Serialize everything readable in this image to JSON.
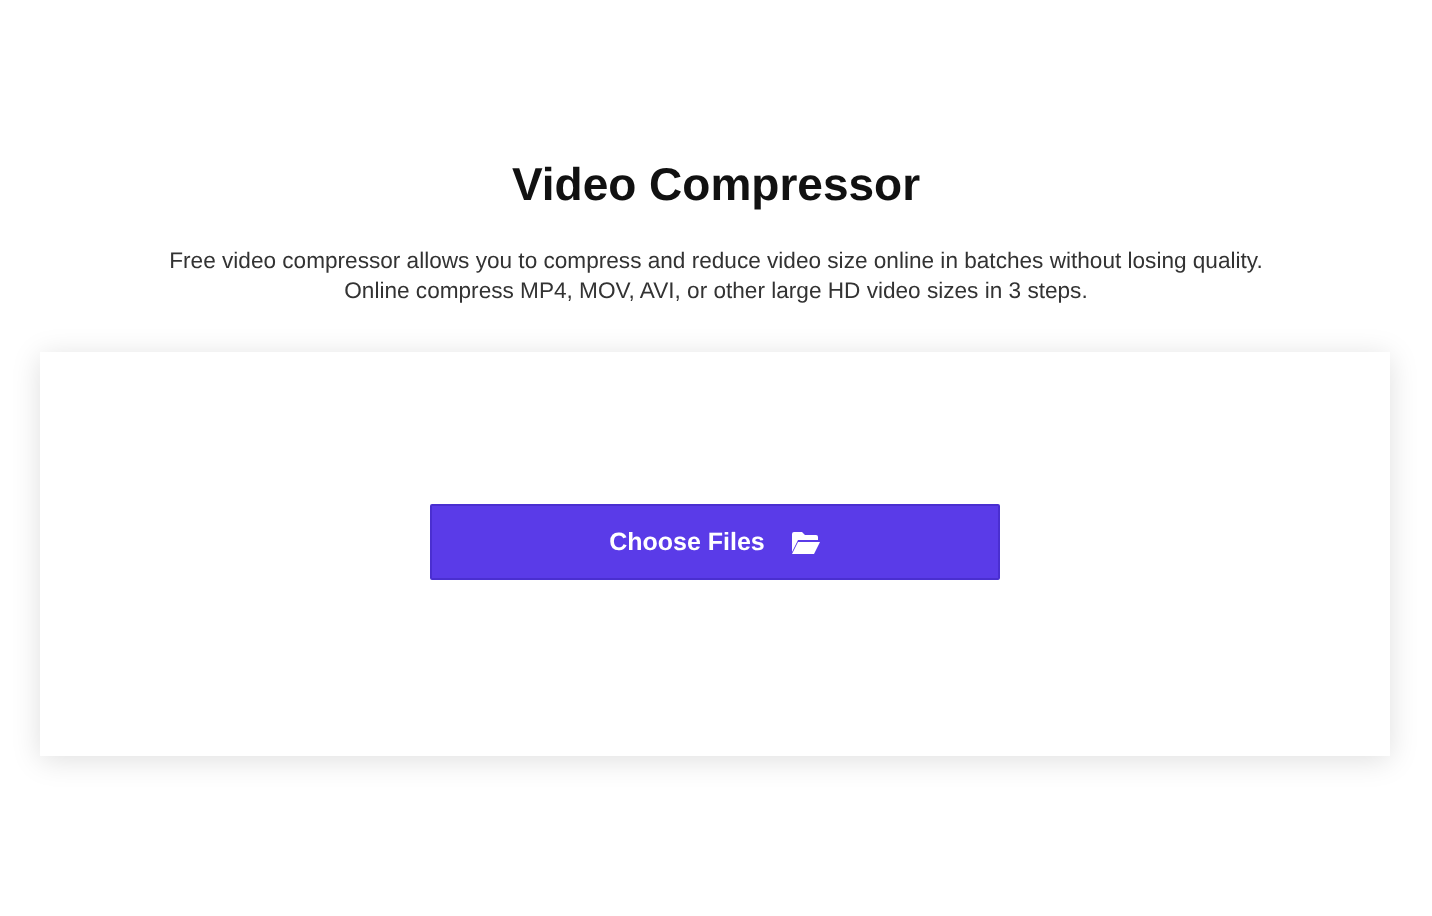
{
  "title": "Video Compressor",
  "description": [
    "Free video compressor allows you to compress and reduce video size online in batches without losing quality.",
    "Online compress MP4, MOV, AVI, or other large HD video sizes in 3 steps."
  ],
  "upload_button": {
    "label": "Choose Files"
  }
}
